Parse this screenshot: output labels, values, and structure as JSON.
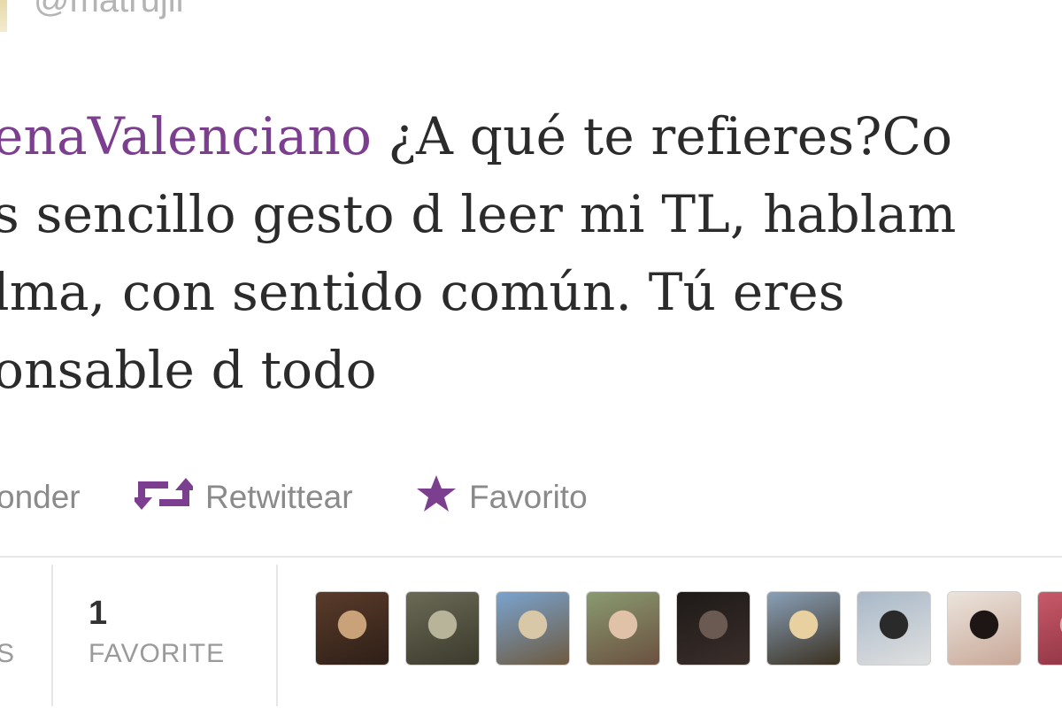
{
  "tweet": {
    "handle": "@matrujil",
    "lines": [
      {
        "mention": "enaValenciano",
        "text": " ¿A qué te refieres?Co"
      },
      {
        "mention": "",
        "text": "s sencillo gesto d leer mi TL, hablam"
      },
      {
        "mention": "",
        "text": "lma, con sentido común. Tú eres"
      },
      {
        "mention": "",
        "text": "onsable d todo"
      }
    ]
  },
  "actions": {
    "reply_label": "onder",
    "retweet_label": "Retwittear",
    "favorite_label": "Favorito",
    "icons": [
      "reply-icon",
      "retweet-icon",
      "star-icon"
    ],
    "accent_color": "#7c3f8f"
  },
  "stats": {
    "retweets_label_fragment": "S",
    "favorites_count": "1",
    "favorites_label": "FAVORITE"
  },
  "favoriters": [
    {
      "name": "avatar-1",
      "colors": [
        "#5a3b2a",
        "#c9a27a",
        "#2e1f17"
      ]
    },
    {
      "name": "avatar-2",
      "colors": [
        "#6b6a56",
        "#b8b49a",
        "#3b3a2c"
      ]
    },
    {
      "name": "avatar-3",
      "colors": [
        "#7aa3cf",
        "#d8c8a8",
        "#6d5a40"
      ]
    },
    {
      "name": "avatar-4",
      "colors": [
        "#8a9a70",
        "#e0c2a8",
        "#6a5040"
      ]
    },
    {
      "name": "avatar-5",
      "colors": [
        "#1e1a18",
        "#6a5a52",
        "#3a2e2a"
      ]
    },
    {
      "name": "avatar-6",
      "colors": [
        "#8aa0b8",
        "#e8d0a0",
        "#3a3020"
      ]
    },
    {
      "name": "avatar-7",
      "colors": [
        "#a8b8c8",
        "#2a2a2a",
        "#e0e0e0"
      ]
    },
    {
      "name": "avatar-8",
      "colors": [
        "#ece4dc",
        "#1e1614",
        "#c8a898"
      ]
    },
    {
      "name": "avatar-9",
      "colors": [
        "#c85a6a",
        "#d8b0a8",
        "#8a3040"
      ]
    }
  ]
}
